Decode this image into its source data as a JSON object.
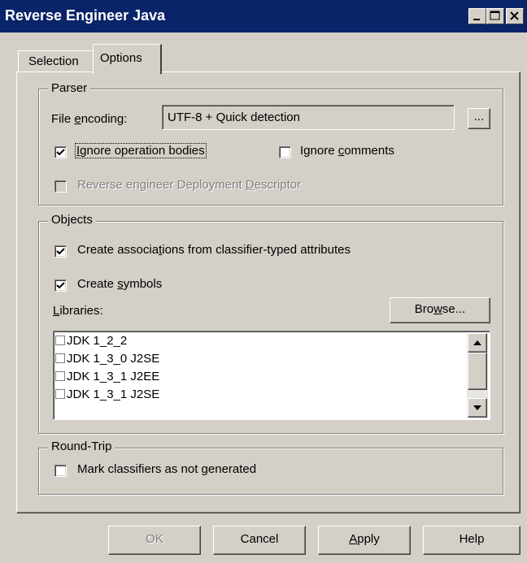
{
  "window": {
    "title": "Reverse Engineer Java"
  },
  "tabs": [
    {
      "label": "Selection",
      "active": false
    },
    {
      "label": "Options",
      "active": true
    }
  ],
  "parser": {
    "legend": "Parser",
    "file_encoding_label_pre": "File ",
    "file_encoding_label_accel": "e",
    "file_encoding_label_post": "ncoding:",
    "file_encoding_value": "UTF-8 + Quick detection",
    "browse_encoding_label": "...",
    "ignore_bodies": {
      "pre": "",
      "accel": "I",
      "post": "gnore operation bodies",
      "checked": true
    },
    "ignore_comments": {
      "pre": "Ignore ",
      "accel": "c",
      "post": "omments",
      "checked": false
    },
    "deployment": {
      "pre": "Reverse engineer Deployment ",
      "accel": "D",
      "post": "escriptor",
      "checked": false,
      "enabled": false
    }
  },
  "objects": {
    "legend": "Objects",
    "create_associations": {
      "pre": "Create associa",
      "accel": "t",
      "post": "ions from classifier-typed attributes",
      "checked": true
    },
    "create_symbols": {
      "pre": "Create ",
      "accel": "s",
      "post": "ymbols",
      "checked": true
    },
    "libraries_label_accel": "L",
    "libraries_label_post": "ibraries:",
    "browse_pre": "Bro",
    "browse_accel": "w",
    "browse_post": "se...",
    "libraries": [
      {
        "label": "JDK 1_2_2",
        "checked": false
      },
      {
        "label": "JDK 1_3_0 J2SE",
        "checked": false
      },
      {
        "label": "JDK 1_3_1 J2EE",
        "checked": false
      },
      {
        "label": "JDK 1_3_1 J2SE",
        "checked": false
      }
    ]
  },
  "roundtrip": {
    "legend": "Round-Trip",
    "mark_not_generated": {
      "pre": "Mark classifiers as not ",
      "accel": "g",
      "post": "enerated",
      "checked": false
    }
  },
  "buttons": {
    "ok": "OK",
    "cancel": "Cancel",
    "apply_accel": "A",
    "apply_post": "pply",
    "help": "Help"
  },
  "colors": {
    "titlebar": "#0a246a",
    "face": "#d4d0c8",
    "disabled_text": "#808080"
  }
}
